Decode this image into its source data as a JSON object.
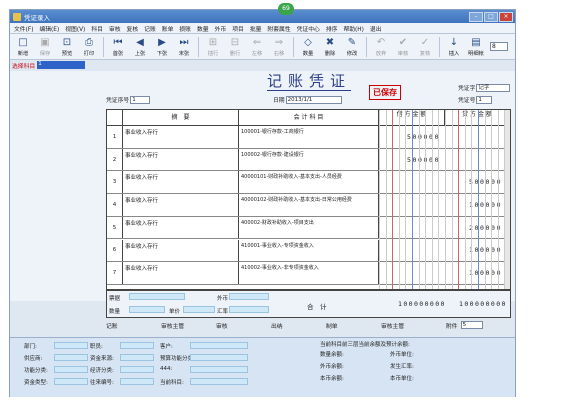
{
  "window": {
    "title": "凭证录入",
    "badge": "69"
  },
  "menu": [
    "文件(F)",
    "编辑(E)",
    "视图(V)",
    "科目",
    "审核",
    "复核",
    "记账",
    "账单",
    "损账",
    "数量",
    "外币",
    "项目",
    "批量",
    "附套属性",
    "凭证中心",
    "排序",
    "帮助(H)",
    "退出"
  ],
  "toolbar": {
    "buttons": [
      {
        "label": "新增",
        "icon": "□",
        "enabled": true
      },
      {
        "label": "保存",
        "icon": "▣",
        "enabled": false
      },
      {
        "label": "预览",
        "icon": "⊡",
        "enabled": true
      },
      {
        "label": "打印",
        "icon": "⎙",
        "enabled": true
      },
      {
        "label": "首张",
        "icon": "⏮",
        "enabled": true
      },
      {
        "label": "上张",
        "icon": "◀",
        "enabled": true
      },
      {
        "label": "下张",
        "icon": "▶",
        "enabled": true
      },
      {
        "label": "末张",
        "icon": "⏭",
        "enabled": true
      },
      {
        "label": "插行",
        "icon": "⊞",
        "enabled": false
      },
      {
        "label": "删行",
        "icon": "⊟",
        "enabled": false
      },
      {
        "label": "左移",
        "icon": "⇐",
        "enabled": false
      },
      {
        "label": "右移",
        "icon": "⇒",
        "enabled": false
      },
      {
        "label": "数量",
        "icon": "◇",
        "enabled": true
      },
      {
        "label": "删除",
        "icon": "✖",
        "enabled": true
      },
      {
        "label": "修改",
        "icon": "✎",
        "enabled": true
      },
      {
        "label": "放弃",
        "icon": "↶",
        "enabled": false
      },
      {
        "label": "审核",
        "icon": "✔",
        "enabled": false
      },
      {
        "label": "复核",
        "icon": "✓",
        "enabled": false
      },
      {
        "label": "插入",
        "icon": "↓",
        "enabled": true
      },
      {
        "label": "明细帐",
        "icon": "▤",
        "enabled": true
      }
    ],
    "selector_value": "8"
  },
  "filter": {
    "label": "选择科目",
    "value": "1"
  },
  "voucher": {
    "title": "记账凭证",
    "stamp": "已保存",
    "voucher_type_label": "凭证字",
    "voucher_type_value": "记字",
    "voucher_no_label": "凭证号",
    "voucher_no_value": "1",
    "entry_no_label": "凭证序号",
    "entry_no_value": "1",
    "date_label": "日期",
    "date_value": "2013/1/1",
    "col_summary": "摘　要",
    "col_account": "会 计 科 目",
    "col_debit": "借 方 金 额",
    "col_credit": "贷 方 金 额",
    "total_label": "合　计",
    "total_debit": "100000000",
    "total_credit": "100000000"
  },
  "rows": [
    {
      "no": "1",
      "summary": "事业收入存行",
      "account": "100001-银行存款-工商银行",
      "debit": "500000",
      "credit": ""
    },
    {
      "no": "2",
      "summary": "事业收入存行",
      "account": "100002-银行存款-建设银行",
      "debit": "500000",
      "credit": ""
    },
    {
      "no": "3",
      "summary": "事业收入存行",
      "account": "40000101-财政补助收入-基本支出-人员经费",
      "debit": "",
      "credit": "500000"
    },
    {
      "no": "4",
      "summary": "事业收入存行",
      "account": "40000102-财政补助收入-基本支出-日常公用经费",
      "debit": "",
      "credit": "100000"
    },
    {
      "no": "5",
      "summary": "事业收入存行",
      "account": "400002-财政补助收入-项目支出",
      "debit": "",
      "credit": "200000"
    },
    {
      "no": "6",
      "summary": "事业收入存行",
      "account": "410001-事业收入-专项资金收入",
      "debit": "",
      "credit": "100000"
    },
    {
      "no": "7",
      "summary": "事业收入存行",
      "account": "410002-事业收入-非专项资金收入",
      "debit": "",
      "credit": "100000"
    }
  ],
  "bottom": {
    "qty_label": "数量",
    "price_label": "单价",
    "foreign_label": "外币",
    "rate_label": "汇率",
    "settle_label": "票据",
    "sign": [
      "记账",
      "审核主管",
      "审核",
      "出纳",
      "制单",
      "审核主管"
    ],
    "attach_label": "附件",
    "attach_value": "5"
  },
  "info": {
    "left": [
      "部门:",
      "职员:",
      "客户:",
      "供应商:",
      "资金来源:",
      "预算功能分类:",
      "功能分类:",
      "经济分类:",
      "444:",
      "资金类型:",
      "往来编号:",
      "当前科目:"
    ],
    "right_header": "当前科目前三层当前余额及预计余额:",
    "right": [
      "数量余额:",
      "外币单位:",
      "外币余额:",
      "发生汇率:",
      "本币余额:",
      "本币单位:"
    ]
  }
}
